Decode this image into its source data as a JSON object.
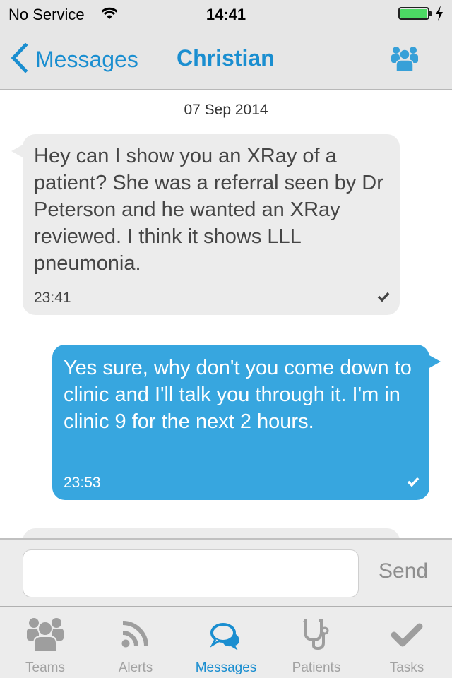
{
  "status_bar": {
    "carrier": "No Service",
    "time": "14:41",
    "battery_level": 1.0
  },
  "nav": {
    "back_label": "Messages",
    "title": "Christian",
    "right_icon": "group-icon"
  },
  "conversation": {
    "date": "07 Sep 2014",
    "messages": [
      {
        "direction": "incoming",
        "text": "Hey can I show you an XRay of a patient? She was a referral seen by Dr Peterson and he wanted an XRay reviewed. I think it shows LLL pneumonia.",
        "time": "23:41",
        "status_icon": "checkmark-icon"
      },
      {
        "direction": "outgoing",
        "text": "Yes sure, why don't you come down to clinic and I'll talk you through it. I'm in clinic 9 for the next 2 hours.",
        "time": "23:53",
        "status_icon": "checkmark-icon"
      }
    ]
  },
  "composer": {
    "input_value": "",
    "input_placeholder": "",
    "send_label": "Send"
  },
  "tabs": [
    {
      "label": "Teams",
      "icon": "teams-icon",
      "active": false
    },
    {
      "label": "Alerts",
      "icon": "rss-icon",
      "active": false
    },
    {
      "label": "Messages",
      "icon": "chat-bubbles-icon",
      "active": true
    },
    {
      "label": "Patients",
      "icon": "stethoscope-icon",
      "active": false
    },
    {
      "label": "Tasks",
      "icon": "checkmark-icon",
      "active": false
    }
  ],
  "colors": {
    "accent": "#1a8ed0",
    "outgoing_bubble": "#37a6df",
    "incoming_bubble": "#ececec",
    "inactive_tab": "#a2a2a2",
    "battery": "#4cd964"
  }
}
